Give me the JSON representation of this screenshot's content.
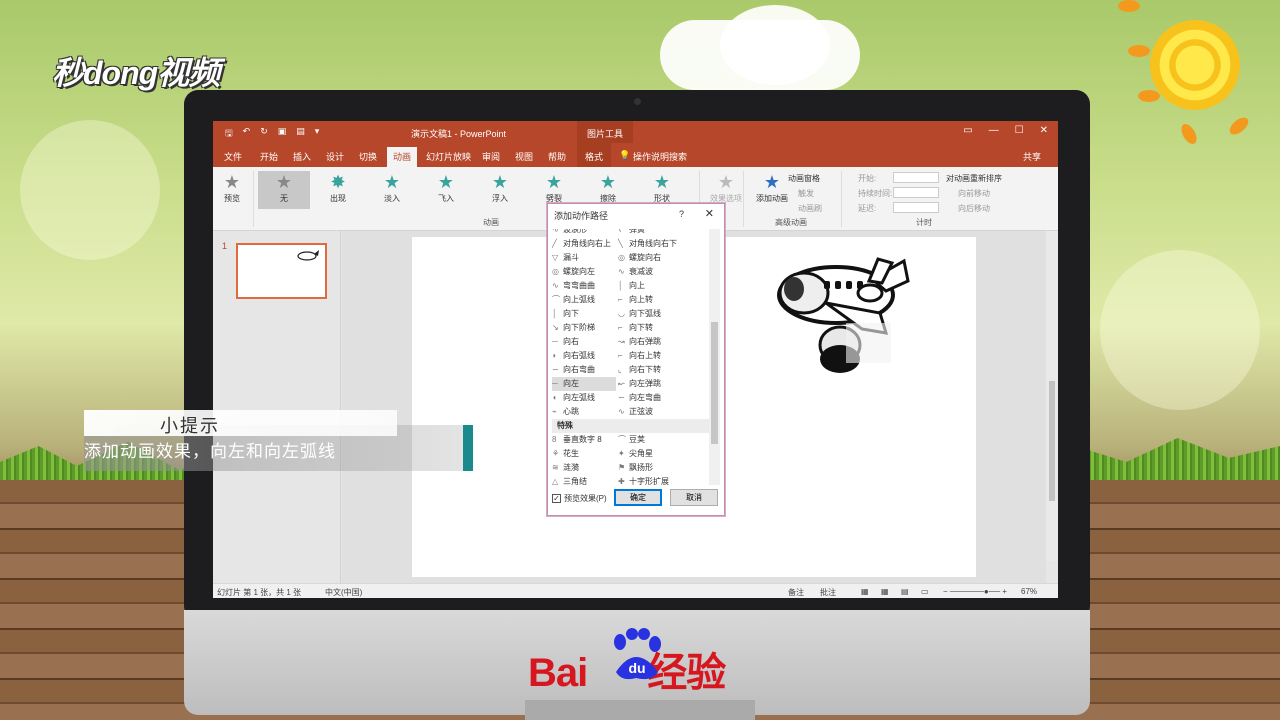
{
  "watermark": {
    "brand": "秒dong视频"
  },
  "caption": {
    "title": "小提示",
    "text": "添加动画效果，向左和向左弧线"
  },
  "footer_logo": {
    "bai": "Bai",
    "du": "du",
    "jingyan": "经验"
  },
  "ppt": {
    "doc_title": "演示文稿1 - PowerPoint",
    "context_group": "图片工具",
    "menu": [
      "文件",
      "开始",
      "插入",
      "设计",
      "切换",
      "动画",
      "幻灯片放映",
      "审阅",
      "视图",
      "帮助",
      "格式"
    ],
    "active_tab": "动画",
    "search_hint": "操作说明搜索",
    "share": "共享",
    "ribbon": {
      "preview": "预览",
      "effects": [
        "无",
        "出现",
        "淡入",
        "飞入",
        "浮入",
        "劈裂",
        "擦除",
        "形状"
      ],
      "effect_options": "效果选项",
      "animation_group": "动画",
      "add_animation": "添加动画",
      "animation_pane": "动画窗格",
      "trigger": "触发",
      "animation_painter": "动画刷",
      "advanced_group": "高级动画",
      "start": "开始:",
      "duration": "持续时间:",
      "delay": "延迟:",
      "reorder": "对动画重新排序",
      "move_earlier": "向前移动",
      "move_later": "向后移动",
      "timing_group": "计时"
    },
    "slide_number": "1",
    "status": {
      "left": "幻灯片 第 1 张，共 1 张",
      "lang": "中文(中国)",
      "notes": "备注",
      "comments": "批注",
      "zoom": "67%"
    }
  },
  "dialog": {
    "title": "添加动作路径",
    "help": "?",
    "close": "✕",
    "items": [
      {
        "l": "波浪形",
        "r": "弹簧"
      },
      {
        "l": "对角线向右上",
        "r": "对角线向右下"
      },
      {
        "l": "漏斗",
        "r": "螺旋向右"
      },
      {
        "l": "螺旋向左",
        "r": "衰减波"
      },
      {
        "l": "弯弯曲曲",
        "r": "向上"
      },
      {
        "l": "向上弧线",
        "r": "向上转"
      },
      {
        "l": "向下",
        "r": "向下弧线"
      },
      {
        "l": "向下阶梯",
        "r": "向下转"
      },
      {
        "l": "向右",
        "r": "向右弹跳"
      },
      {
        "l": "向右弧线",
        "r": "向右上转"
      },
      {
        "l": "向右弯曲",
        "r": "向右下转"
      },
      {
        "l": "向左",
        "r": "向左弹跳"
      },
      {
        "l": "向左弧线",
        "r": "向左弯曲"
      },
      {
        "l": "心跳",
        "r": "正弦波"
      }
    ],
    "section": "特殊",
    "special": [
      {
        "l": "垂直数字 8",
        "r": "豆荚"
      },
      {
        "l": "花生",
        "r": "尖角星"
      },
      {
        "l": "涟漪",
        "r": "飘扬形"
      },
      {
        "l": "三角结",
        "r": "十字形扩展"
      }
    ],
    "preview_label": "预览效果(P)",
    "ok": "确定",
    "cancel": "取消"
  }
}
